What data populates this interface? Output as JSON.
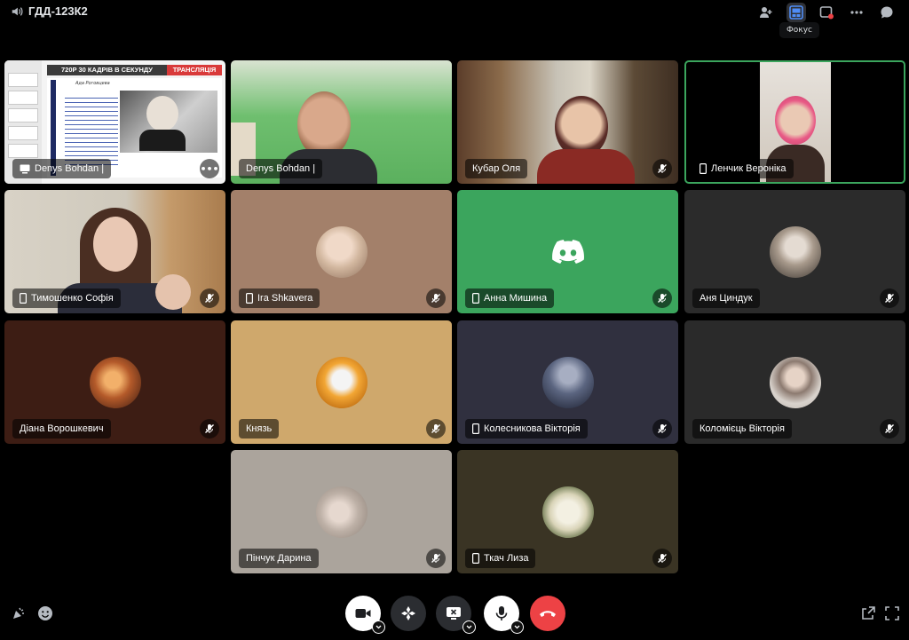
{
  "top": {
    "channel_name": "ГДД-123К2",
    "focus_tooltip": "Фокус",
    "icons": [
      "add-friend-icon",
      "focus-layout-icon",
      "popout-icon",
      "more-icon",
      "chat-icon"
    ]
  },
  "screenshare": {
    "banner_left": "720P 30 КАДРІВ В СЕКУНДУ",
    "banner_right": "ТРАНСЛЯЦІЯ",
    "slide_title": "Ада Роговцева"
  },
  "tiles": [
    {
      "name": "Denys Bohdan |",
      "icon": "screen-icon",
      "muted": false
    },
    {
      "name": "Denys Bohdan |",
      "icon": "",
      "muted": false
    },
    {
      "name": "Кубар Оля",
      "icon": "",
      "muted": true
    },
    {
      "name": "Ленчик Вероніка",
      "icon": "phone-icon",
      "muted": false
    },
    {
      "name": "Тимошенко Софія",
      "icon": "phone-icon",
      "muted": true
    },
    {
      "name": "Ira Shkavera",
      "icon": "phone-icon",
      "muted": true
    },
    {
      "name": "Анна Мишина",
      "icon": "phone-icon",
      "muted": true
    },
    {
      "name": "Аня Циндук",
      "icon": "",
      "muted": true
    },
    {
      "name": "Діана Ворошкевич",
      "icon": "",
      "muted": true
    },
    {
      "name": "Князь",
      "icon": "",
      "muted": true
    },
    {
      "name": "Колесникова Вікторія",
      "icon": "phone-icon",
      "muted": true
    },
    {
      "name": "Коломієць Вікторія",
      "icon": "",
      "muted": true
    },
    {
      "name": "Пінчук Дарина",
      "icon": "",
      "muted": true
    },
    {
      "name": "Ткач Лиза",
      "icon": "phone-icon",
      "muted": true
    }
  ],
  "colors": {
    "focus_outline": "#3ba55d",
    "discord_green": "#3ba55d",
    "hangup_red": "#ed4245",
    "tile_dark": "#2b2d31"
  },
  "controls": [
    "camera-icon",
    "activities-icon",
    "screenshare-off-icon",
    "microphone-icon",
    "hangup-icon"
  ]
}
